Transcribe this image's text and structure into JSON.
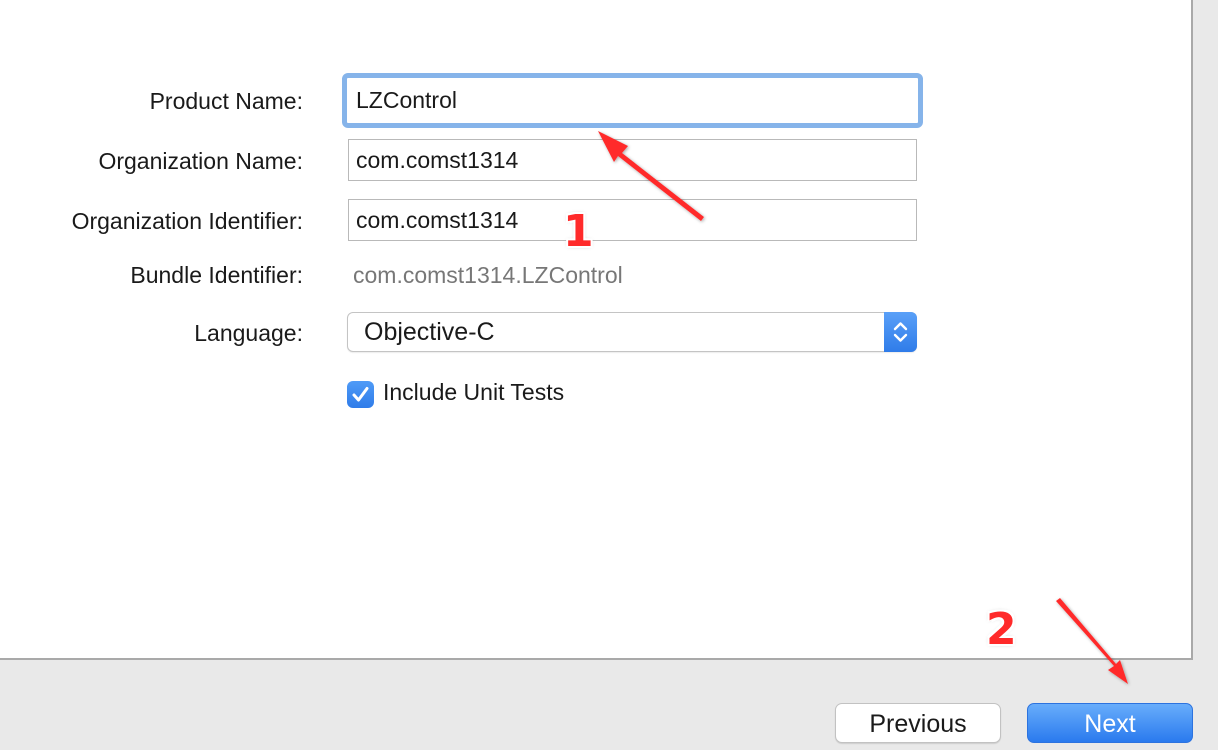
{
  "form": {
    "product_name_label": "Product Name:",
    "product_name_value": "LZControl",
    "organization_name_label": "Organization Name:",
    "organization_name_value": "com.comst1314",
    "organization_identifier_label": "Organization Identifier:",
    "organization_identifier_value": "com.comst1314",
    "bundle_identifier_label": "Bundle Identifier:",
    "bundle_identifier_value": "com.comst1314.LZControl",
    "language_label": "Language:",
    "language_value": "Objective-C",
    "include_unit_tests_label": "Include Unit Tests",
    "include_unit_tests_checked": true
  },
  "buttons": {
    "previous_label": "Previous",
    "next_label": "Next"
  },
  "annotations": {
    "marker_1": "1",
    "marker_2": "2"
  },
  "colors": {
    "accent_blue": "#2f7ce9",
    "annotation_red": "#ff2a2a",
    "focus_ring": "#86b4ea"
  },
  "icons": {
    "language_popup_stepper": "up-down-chevron-icon",
    "checkbox_mark": "checkmark-icon"
  }
}
